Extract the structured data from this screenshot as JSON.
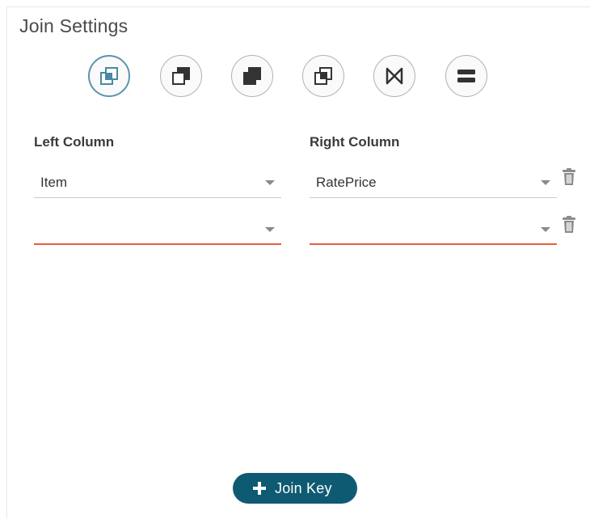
{
  "panel": {
    "title": "Join Settings"
  },
  "join_types": [
    {
      "name": "inner-join",
      "icon": "inner-join-icon",
      "selected": true
    },
    {
      "name": "left-join",
      "icon": "left-join-icon",
      "selected": false
    },
    {
      "name": "outer-join",
      "icon": "outer-join-icon",
      "selected": false
    },
    {
      "name": "right-join",
      "icon": "right-join-icon",
      "selected": false
    },
    {
      "name": "cross-join",
      "icon": "bowtie-join-icon",
      "selected": false
    },
    {
      "name": "union",
      "icon": "union-icon",
      "selected": false
    }
  ],
  "columns": {
    "left_header": "Left Column",
    "right_header": "Right Column"
  },
  "rows": [
    {
      "left_value": "Item",
      "right_value": "RatePrice",
      "left_error": false,
      "right_error": false
    },
    {
      "left_value": "",
      "right_value": "",
      "left_error": true,
      "right_error": true
    }
  ],
  "buttons": {
    "join_key_label": "Join Key"
  },
  "colors": {
    "accent": "#0f5a73",
    "selected_ring": "#5e93ab",
    "selected_fill": "#4a88a3",
    "error_underline": "#ec5b3a",
    "icon_dark": "#333333"
  },
  "icons": {
    "delete": "trash-icon",
    "dropdown": "chevron-down-icon",
    "add": "plus-icon"
  }
}
